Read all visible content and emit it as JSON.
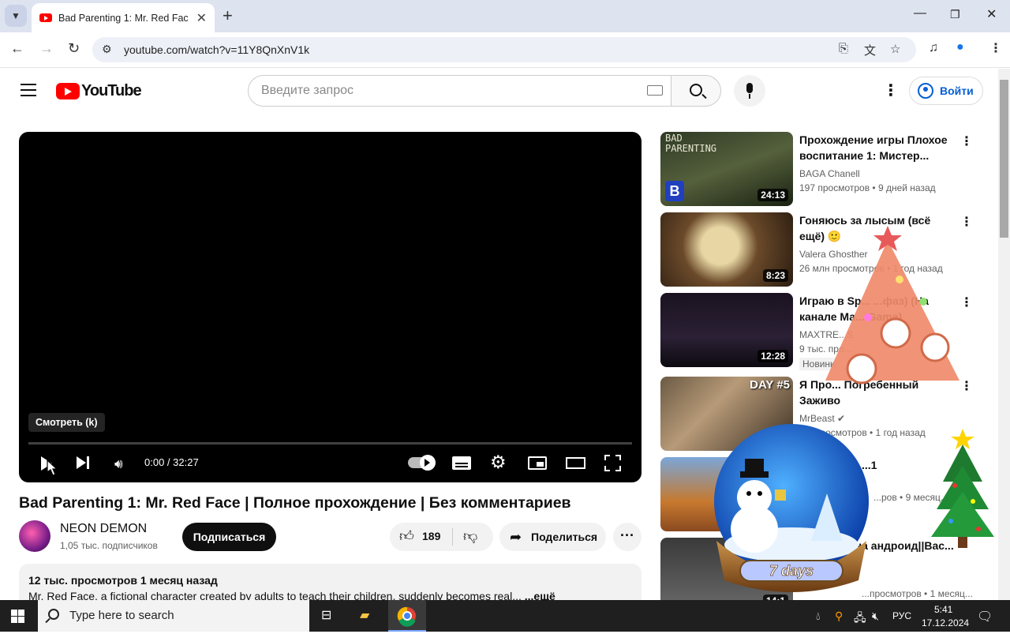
{
  "browser": {
    "tab_title": "Bad Parenting 1: Mr. Red Face |",
    "url": "youtube.com/watch?v=11Y8QnXnV1k"
  },
  "header": {
    "logo_text": "YouTube",
    "search_placeholder": "Введите запрос",
    "signin_label": "Войти"
  },
  "player": {
    "tooltip": "Смотреть (k)",
    "time": "0:00 / 32:27"
  },
  "video": {
    "title": "Bad Parenting 1: Mr. Red Face | Полное прохождение | Без комментариев",
    "channel_name": "NEON DEMON",
    "subscribers": "1,05 тыс. подписчиков",
    "subscribe_label": "Подписаться",
    "likes": "189",
    "share_label": "Поделиться",
    "desc_meta": "12 тыс. просмотров  1 месяц назад",
    "desc_text": "Mr. Red Face, a fictional character created by adults to teach their children, suddenly becomes real...",
    "desc_more": "...ещё"
  },
  "recommendations": [
    {
      "title": "Прохождение игры Плохое воспитание 1: Мистер...",
      "channel": "BAGA Chanell",
      "meta": "197 просмотров • 9 дней назад",
      "duration": "24:13",
      "thumb_text": "BAD PARENTING"
    },
    {
      "title": "Гоняюсь за лысым (всё ещё) 🙂",
      "channel": "Valera Ghosther",
      "meta": "26 млн просмотров • 1 год назад",
      "duration": "8:23"
    },
    {
      "title": "Играю в Sp... ...фаз) (На канале Ма... Game)",
      "channel": "MAXTRE...S",
      "meta": "9 тыс. про...",
      "duration": "12:28",
      "badge": "Новинк"
    },
    {
      "title": "Я Про... Погребенный Заживо",
      "channel": "MrBeast",
      "meta": "...н просмотров • 1 год назад",
      "thumb_text": "DAY #5"
    },
    {
      "title": "...1",
      "channel": "",
      "meta": "...ров • 9 месяц..."
    },
    {
      "title": "...на андроид||Bac...",
      "channel": "",
      "meta": "...просмотров • 1 месяц...",
      "duration": "14:1"
    }
  ],
  "decorations": {
    "globe_label": "7 days"
  },
  "taskbar": {
    "search_placeholder": "Type here to search",
    "lang": "РУС",
    "time": "5:41",
    "date": "17.12.2024"
  }
}
